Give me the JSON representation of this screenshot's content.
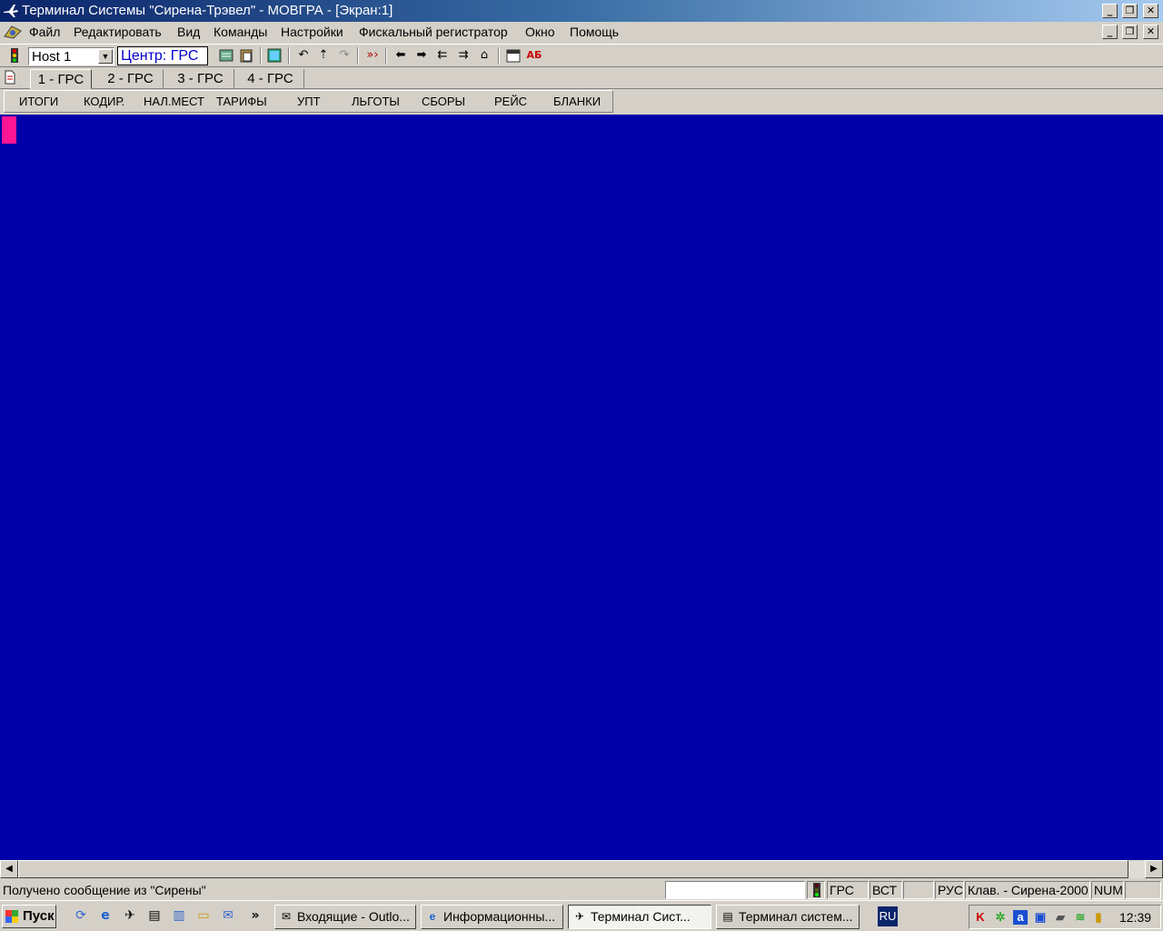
{
  "window": {
    "title": "Терминал Системы \"Сирена-Трэвел\" - МОВГРА - [Экран:1]",
    "controls": [
      "_",
      "❐",
      "✕"
    ]
  },
  "menu": {
    "items": [
      "Файл",
      "Редактировать",
      "Вид",
      "Команды",
      "Настройки",
      "Фискальный регистратор",
      "Окно",
      "Помощь"
    ]
  },
  "toolbar": {
    "host": "Host 1",
    "center": "Центр: ГРС"
  },
  "tabs": [
    "1 - ГРС",
    "2 - ГРС",
    "3 - ГРС",
    "4 - ГРС"
  ],
  "functions": [
    "ИТОГИ",
    "КОДИР.",
    "НАЛ.МЕСТ",
    "ТАРИФЫ",
    "УПТ",
    "ЛЬГОТЫ",
    "СБОРЫ",
    "РЕЙС",
    "БЛАНКИ"
  ],
  "status": {
    "message": "Получено сообщение из \"Сирены\"",
    "grs": "ГРС",
    "vst": "ВСТ",
    "rus": "РУС",
    "keyboard": "Клав. - Сирена-2000",
    "num": "NUM"
  },
  "taskbar": {
    "start": "Пуск",
    "tasks": [
      "Входящие - Outlo...",
      "Информационны...",
      "Терминал Сист...",
      "Терминал систем..."
    ],
    "lang": "RU",
    "clock": "12:39"
  },
  "colors": {
    "terminal_bg": "#0000a8",
    "cursor": "#ff1493",
    "title_gradient_start": "#0a246a"
  }
}
